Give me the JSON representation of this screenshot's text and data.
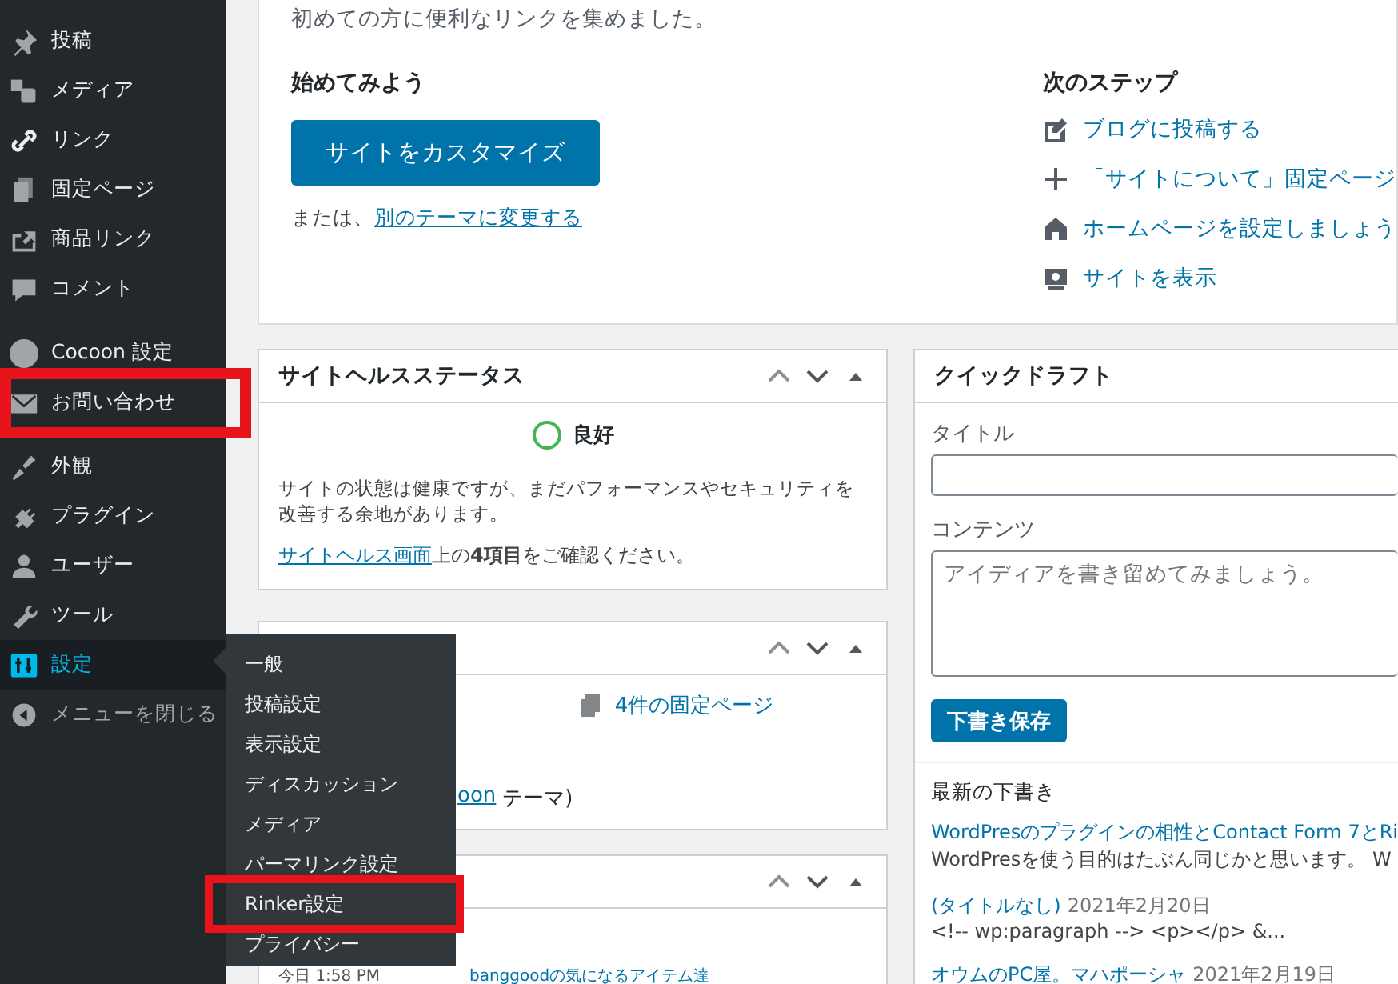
{
  "sidebar": {
    "groups": [
      {
        "items": [
          {
            "label": "投稿",
            "selected": false
          },
          {
            "label": "メディア",
            "selected": false
          },
          {
            "label": "リンク",
            "selected": false
          },
          {
            "label": "固定ページ",
            "selected": false
          },
          {
            "label": "商品リンク",
            "selected": false
          },
          {
            "label": "コメント",
            "selected": false
          }
        ]
      },
      {
        "items": [
          {
            "label": "Cocoon 設定",
            "selected": false
          },
          {
            "label": "お問い合わせ",
            "selected": false
          }
        ]
      },
      {
        "items": [
          {
            "label": "外観",
            "selected": false
          },
          {
            "label": "プラグイン",
            "selected": false
          },
          {
            "label": "ユーザー",
            "selected": false
          },
          {
            "label": "ツール",
            "selected": false
          },
          {
            "label": "設定",
            "selected": true
          },
          {
            "label": "メニューを閉じる",
            "selected": false
          }
        ]
      }
    ]
  },
  "submenu": {
    "items": [
      {
        "label": "一般",
        "selected": false
      },
      {
        "label": "投稿設定",
        "selected": false
      },
      {
        "label": "表示設定",
        "selected": false
      },
      {
        "label": "ディスカッション",
        "selected": false
      },
      {
        "label": "メディア",
        "selected": false
      },
      {
        "label": "パーマリンク設定",
        "selected": false
      },
      {
        "label": "Rinker設定",
        "selected": false
      },
      {
        "label": "プライバシー",
        "selected": false
      }
    ]
  },
  "welcome": {
    "intro": "初めての方に便利なリンクを集めました。",
    "start_heading": "始めてみよう",
    "customize_button": "サイトをカスタマイズ",
    "or_text": "または、",
    "change_theme_link": "別のテーマに変更する",
    "next_heading": "次のステップ",
    "next_steps": [
      "ブログに投稿する",
      "「サイトについて」固定ページ",
      "ホームページを設定しましょう",
      "サイトを表示"
    ]
  },
  "site_health": {
    "title": "サイトヘルスステータス",
    "status": "良好",
    "description": "サイトの状態は健康ですが、まだパフォーマンスやセキュリティを改善する余地があります。",
    "link": "サイトヘルス画面",
    "rest": "上の**4項目**をご確認ください。"
  },
  "glance": {
    "pages_link": "4件の固定ページ",
    "theme_link": "oon",
    "theme_suffix": "テーマ)"
  },
  "activity": {
    "time": "今日 1:58 PM",
    "post_link": "banggoodの気になるアイテム達"
  },
  "quick_draft": {
    "title": "クイックドラフト",
    "title_label": "タイトル",
    "content_label": "コンテンツ",
    "content_placeholder": "アイディアを書き留めてみましょう。",
    "save_button": "下書き保存",
    "recent_heading": "最新の下書き",
    "drafts": [
      {
        "title": "WordPresのプラグインの相性とContact Form 7とRi",
        "excerpt": "WordPresを使う目的はたぶん同じかと思います。 W"
      },
      {
        "title": "(タイトルなし)",
        "date": "2021年2月20日",
        "excerpt": "<!-- wp:paragraph --> <p></p> &..."
      },
      {
        "title": "オウムのPC屋。マハポーシャ",
        "date": "2021年2月19日"
      }
    ]
  }
}
